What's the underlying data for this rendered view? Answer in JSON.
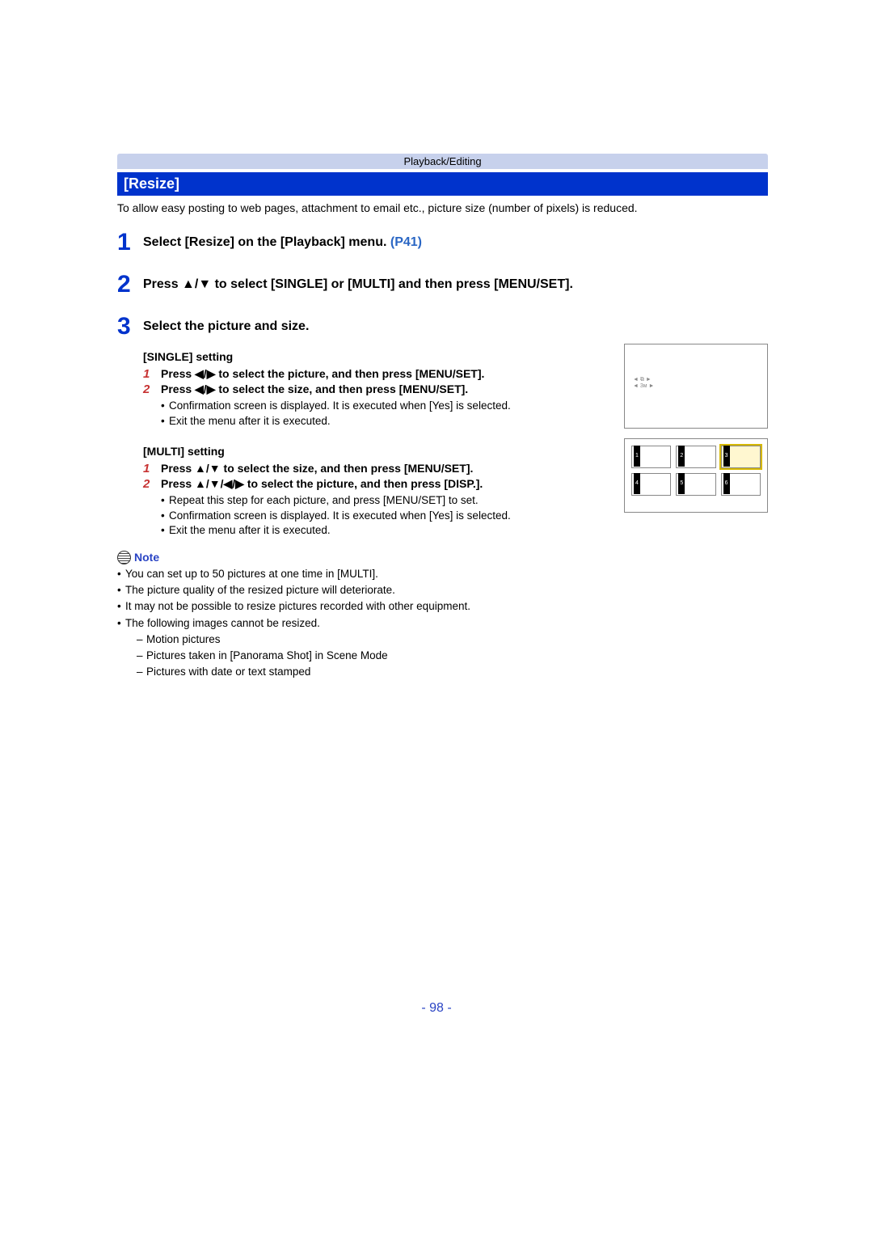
{
  "breadcrumb": "Playback/Editing",
  "section_title": "[Resize]",
  "intro": "To allow easy posting to web pages, attachment to email etc., picture size (number of pixels) is reduced.",
  "steps": {
    "s1": {
      "num": "1",
      "text_a": "Select [Resize] on the [Playback] menu. ",
      "link": "(P41)"
    },
    "s2": {
      "num": "2",
      "text": "Press ▲/▼ to select [SINGLE] or [MULTI] and then press [MENU/SET]."
    },
    "s3": {
      "num": "3",
      "text": "Select the picture and size."
    }
  },
  "single": {
    "heading": "[SINGLE] setting",
    "sub1": {
      "num": "1",
      "text": "Press ◀/▶ to select the picture, and then press [MENU/SET]."
    },
    "sub2": {
      "num": "2",
      "text": "Press ◀/▶ to select the size, and then press [MENU/SET]."
    },
    "bullets": [
      "Confirmation screen is displayed. It is executed when [Yes] is selected.",
      "Exit the menu after it is executed."
    ]
  },
  "multi": {
    "heading": "[MULTI] setting",
    "sub1": {
      "num": "1",
      "text": "Press ▲/▼ to select the size, and then press [MENU/SET]."
    },
    "sub2": {
      "num": "2",
      "text": "Press ▲/▼/◀/▶ to select the picture, and then press [DISP.]."
    },
    "bullets": [
      "Repeat this step for each picture, and press [MENU/SET] to set.",
      "Confirmation screen is displayed. It is executed when [Yes] is selected.",
      "Exit the menu after it is executed."
    ]
  },
  "note": {
    "label": "Note",
    "items": [
      "You can set up to 50 pictures at one time in [MULTI].",
      "The picture quality of the resized picture will deteriorate.",
      "It may not be possible to resize pictures recorded with other equipment.",
      "The following images cannot be resized."
    ],
    "sub_items": [
      "Motion pictures",
      "Pictures taken in [Panorama Shot] in Scene Mode",
      "Pictures with date or text stamped"
    ]
  },
  "page_number": "- 98 -"
}
